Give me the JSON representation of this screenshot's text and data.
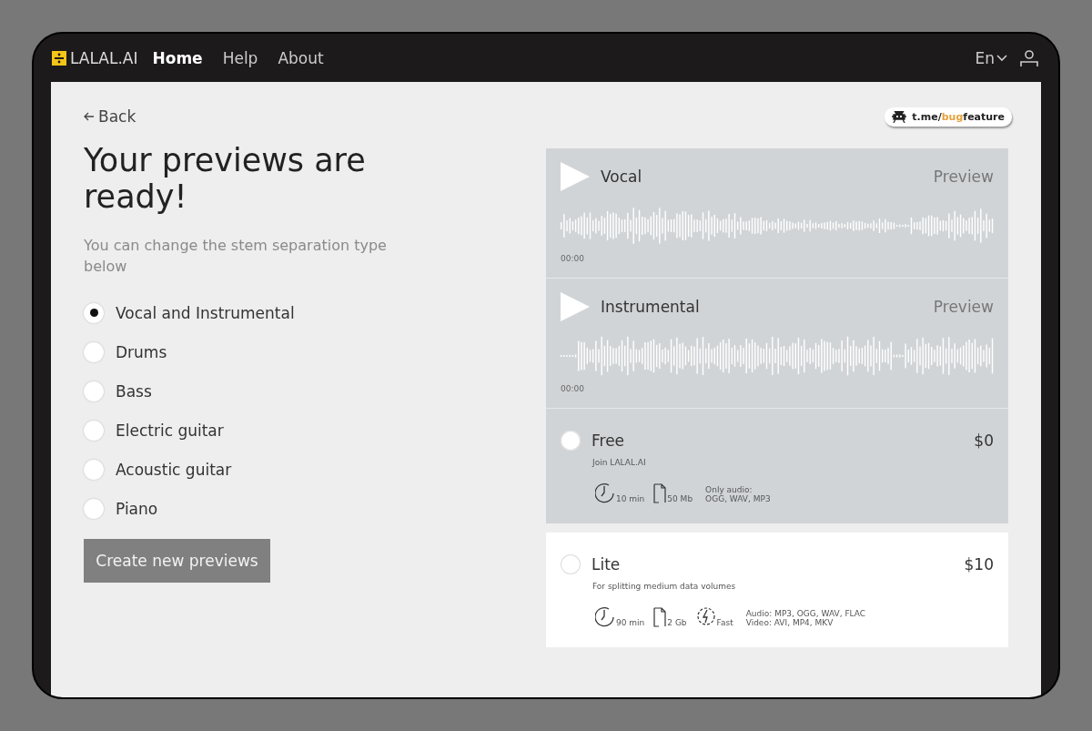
{
  "nav": {
    "logo": "LALAL.AI",
    "links": [
      {
        "label": "Home",
        "selected": true
      },
      {
        "label": "Help",
        "selected": false
      },
      {
        "label": "About",
        "selected": false
      }
    ],
    "language": "En"
  },
  "back": "Back",
  "badge": {
    "prefix": "t.me/",
    "accent": "bug",
    "suffix": "feature"
  },
  "title": "Your previews are ready!",
  "subtitle": "You can change the stem separation type below",
  "stems": [
    {
      "label": "Vocal and Instrumental",
      "selected": true
    },
    {
      "label": "Drums",
      "selected": false
    },
    {
      "label": "Bass",
      "selected": false
    },
    {
      "label": "Electric guitar",
      "selected": false
    },
    {
      "label": "Acoustic guitar",
      "selected": false
    },
    {
      "label": "Piano",
      "selected": false
    }
  ],
  "create_button": "Create new previews",
  "tracks": [
    {
      "name": "Vocal",
      "action": "Preview",
      "time": "00:00"
    },
    {
      "name": "Instrumental",
      "action": "Preview",
      "time": "00:00"
    }
  ],
  "plans": [
    {
      "name": "Free",
      "price": "$0",
      "description": "Join LALAL.AI",
      "selected": false,
      "highlighted": true,
      "features": [
        {
          "kind": "time",
          "text": "10 min"
        },
        {
          "kind": "size",
          "text": "50 Mb"
        }
      ],
      "formats": [
        "Only audio:",
        "OGG, WAV, MP3"
      ]
    },
    {
      "name": "Lite",
      "price": "$10",
      "description": "For splitting medium data volumes",
      "selected": false,
      "highlighted": false,
      "features": [
        {
          "kind": "time",
          "text": "90 min"
        },
        {
          "kind": "size",
          "text": "2 Gb"
        },
        {
          "kind": "speed",
          "text": "Fast"
        }
      ],
      "formats": [
        "Audio: MP3, OGG, WAV, FLAC",
        "Video: AVI, MP4, MKV"
      ]
    }
  ]
}
